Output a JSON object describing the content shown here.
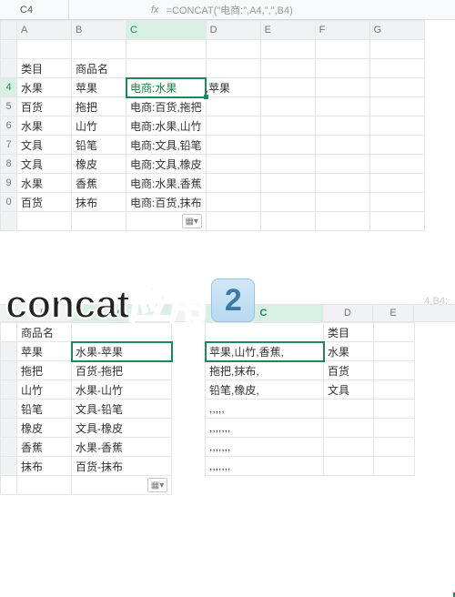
{
  "toolbar": {
    "namebox": "C4",
    "fx_icon": "fx",
    "formula": "=CONCAT(\"电商:\",A4,\",\",B4)"
  },
  "cols": [
    "A",
    "B",
    "C",
    "D",
    "E",
    "F",
    "G"
  ],
  "top": {
    "headers": {
      "A": "类目",
      "B": "商品名"
    },
    "rows": [
      {
        "n": "4",
        "a": "水果",
        "b": "苹果",
        "c": "电商:水果",
        "c2": ",苹果",
        "active": true
      },
      {
        "n": "5",
        "a": "百货",
        "b": "拖把",
        "c": "电商:百货,拖把"
      },
      {
        "n": "6",
        "a": "水果",
        "b": "山竹",
        "c": "电商:水果,山竹"
      },
      {
        "n": "7",
        "a": "文具",
        "b": "铅笔",
        "c": "电商:文具,铅笔"
      },
      {
        "n": "8",
        "a": "文具",
        "b": "橡皮",
        "c": "电商:文具,橡皮"
      },
      {
        "n": "9",
        "a": "水果",
        "b": "香蕉",
        "c": "电商:水果,香蕉"
      },
      {
        "n": "0",
        "a": "百货",
        "b": "抹布",
        "c": "电商:百货,抹布"
      }
    ]
  },
  "title": {
    "text": "concat应用",
    "num": "2"
  },
  "ghost": "4,B4:",
  "left": {
    "cols": [
      "B",
      "C"
    ],
    "header": "商品名",
    "rows": [
      {
        "b": "苹果",
        "c": "水果-苹果",
        "active": true
      },
      {
        "b": "拖把",
        "c": "百货-拖把"
      },
      {
        "b": "山竹",
        "c": "水果-山竹"
      },
      {
        "b": "铅笔",
        "c": "文具-铅笔"
      },
      {
        "b": "橡皮",
        "c": "文具-橡皮"
      },
      {
        "b": "香蕉",
        "c": "水果-香蕉"
      },
      {
        "b": "抹布",
        "c": "百货-抹布"
      }
    ]
  },
  "right": {
    "cols": [
      "C",
      "D",
      "E"
    ],
    "header": "类目",
    "rows": [
      {
        "c": "苹果,山竹,香蕉,",
        "d": "水果",
        "active": true
      },
      {
        "c": "拖把,抹布,",
        "d": "百货"
      },
      {
        "c": "铅笔,橡皮,",
        "d": "文具"
      },
      {
        "c": ",,,,,"
      },
      {
        "c": ",,,,,,,"
      },
      {
        "c": ",,,,,,,"
      },
      {
        "c": ",,,,,,,"
      }
    ]
  },
  "smart_icon": "▦▾"
}
